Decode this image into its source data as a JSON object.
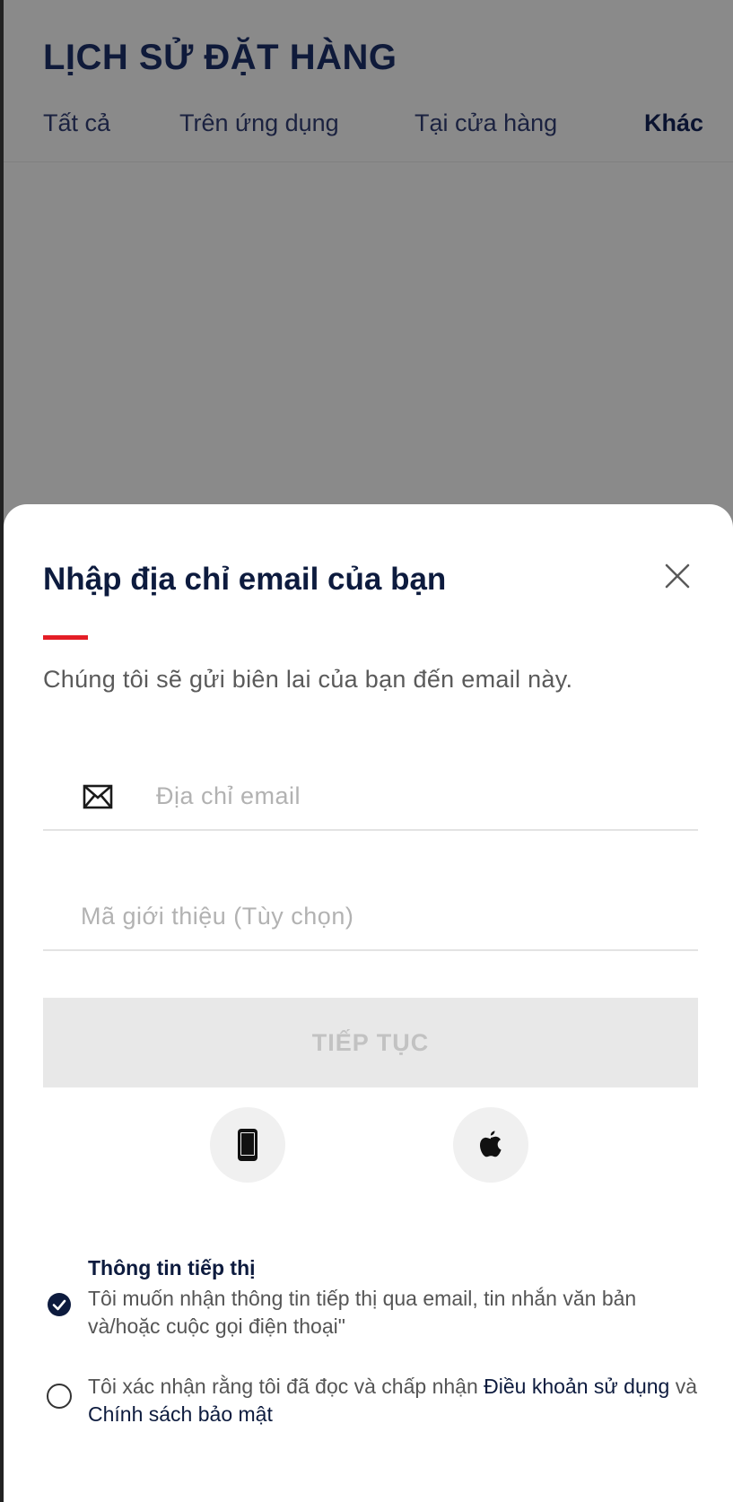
{
  "background_page": {
    "title": "LỊCH SỬ ĐẶT HÀNG",
    "tabs": [
      {
        "label": "Tất cả"
      },
      {
        "label": "Trên ứng dụng"
      },
      {
        "label": "Tại cửa hàng"
      },
      {
        "label": "Khác"
      }
    ],
    "active_tab": "Khác"
  },
  "sheet": {
    "title": "Nhập địa chỉ email của bạn",
    "subtitle": "Chúng tôi sẽ gửi biên lai của bạn đến email này.",
    "email_field": {
      "placeholder": "Địa chỉ email",
      "value": ""
    },
    "referral_field": {
      "placeholder": "Mã giới thiệu (Tùy chọn)",
      "value": ""
    },
    "continue_label": "TIẾP TỤC",
    "social_buttons": [
      {
        "icon": "phone-icon"
      },
      {
        "icon": "apple-icon"
      }
    ],
    "marketing": {
      "heading": "Thông tin tiếp thị",
      "text": "Tôi muốn nhận thông tin tiếp thị qua email, tin nhắn văn bản và/hoặc cuộc gọi điện thoại\"",
      "checked": true
    },
    "terms": {
      "text_before": "Tôi xác nhận rằng tôi đã đọc và chấp nhận ",
      "terms_link": "Điều khoản sử dụng",
      "text_middle": " và ",
      "privacy_link": "Chính sách bảo mật",
      "checked": false
    }
  },
  "colors": {
    "accent": "#e41e26",
    "navy": "#0d1b3e",
    "overlay": "#8a8a8a",
    "disabled_button": "#e8e8e8"
  }
}
